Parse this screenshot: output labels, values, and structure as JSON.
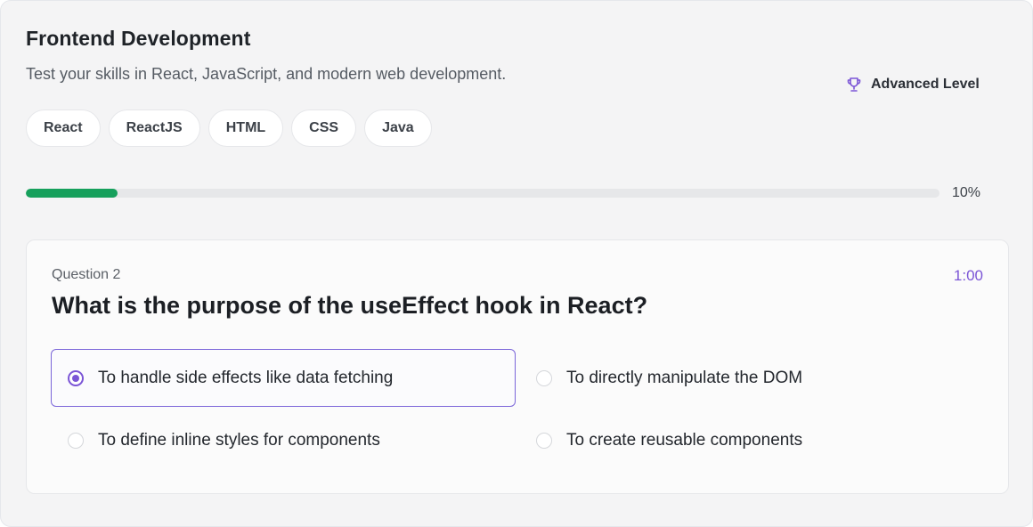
{
  "header": {
    "title": "Frontend Development",
    "subtitle": "Test your skills in React, JavaScript, and modern web development.",
    "level_label": "Advanced Level",
    "level_icon": "trophy-icon",
    "accent_color": "#7b55d6"
  },
  "tags": [
    "React",
    "ReactJS",
    "HTML",
    "CSS",
    "Java"
  ],
  "progress": {
    "value": 0.1,
    "label": "10%",
    "fill_color": "#16a05c"
  },
  "question": {
    "number_label": "Question 2",
    "timer": "1:00",
    "text": "What is the purpose of the useEffect hook in React?",
    "options": [
      {
        "label": "To handle side effects like data fetching",
        "selected": true
      },
      {
        "label": "To directly manipulate the DOM",
        "selected": false
      },
      {
        "label": "To define inline styles for components",
        "selected": false
      },
      {
        "label": "To create reusable components",
        "selected": false
      }
    ]
  }
}
